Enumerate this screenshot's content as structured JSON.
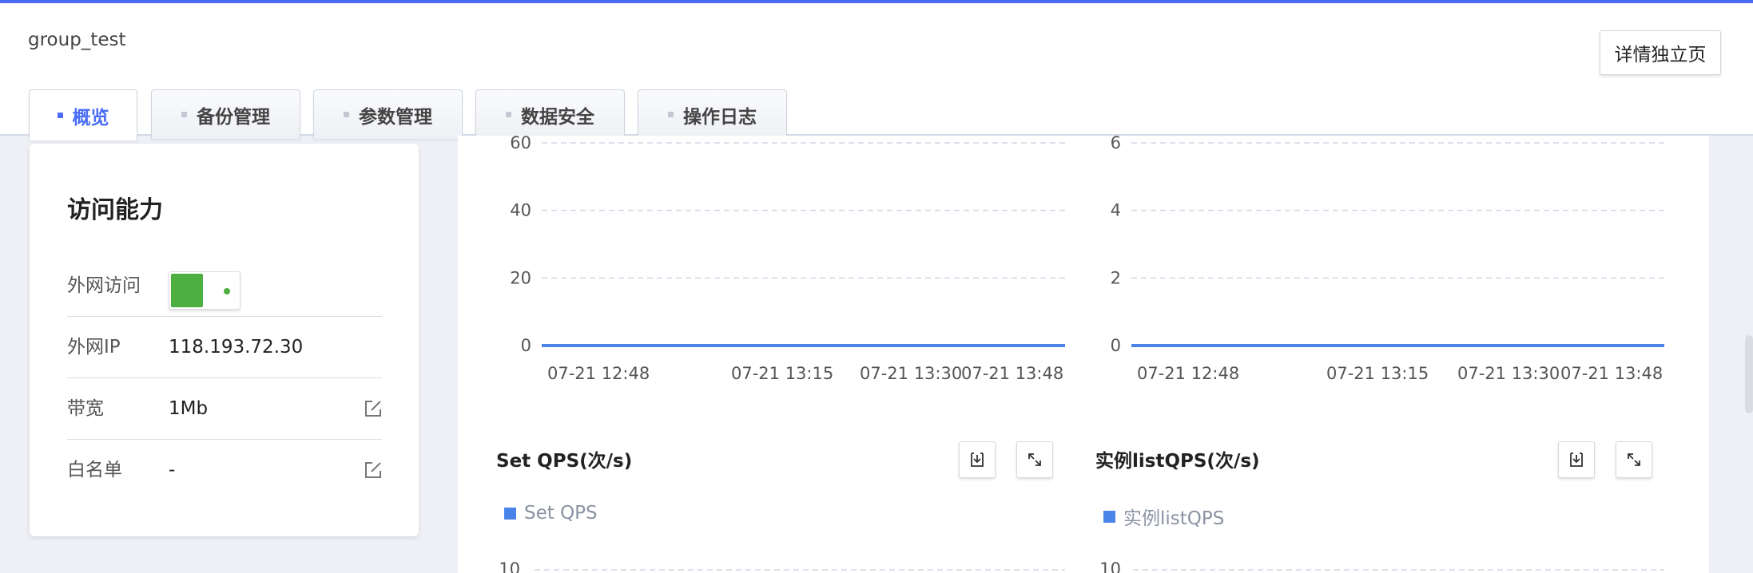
{
  "header": {
    "group_name": "group_test",
    "detail_button": "详情独立页"
  },
  "tabs": [
    {
      "label": "概览",
      "active": true
    },
    {
      "label": "备份管理",
      "active": false
    },
    {
      "label": "参数管理",
      "active": false
    },
    {
      "label": "数据安全",
      "active": false
    },
    {
      "label": "操作日志",
      "active": false
    }
  ],
  "access_card": {
    "title": "访问能力",
    "rows": [
      {
        "label": "外网访问",
        "toggle_on": true
      },
      {
        "label": "外网IP",
        "value": "118.193.72.30"
      },
      {
        "label": "带宽",
        "value": "1Mb",
        "editable": true
      },
      {
        "label": "白名单",
        "value": "-",
        "editable": true
      }
    ]
  },
  "colors": {
    "accent": "#4a6cf7",
    "series": "#4a84e8",
    "toggle_on": "#4caf3f"
  },
  "chart_data": [
    {
      "type": "line",
      "title": "",
      "x": [
        "07-21 12:48",
        "07-21 13:15",
        "07-21 13:30",
        "07-21 13:48"
      ],
      "series": [
        {
          "values": [
            0,
            0,
            0,
            0
          ]
        }
      ],
      "yticks": [
        0,
        20,
        40,
        60
      ],
      "ylim": [
        0,
        60
      ],
      "grid": true
    },
    {
      "type": "line",
      "title": "",
      "x": [
        "07-21 12:48",
        "07-21 13:15",
        "07-21 13:30",
        "07-21 13:48"
      ],
      "series": [
        {
          "values": [
            0,
            0,
            0,
            0
          ]
        }
      ],
      "yticks": [
        0,
        2,
        4,
        6
      ],
      "ylim": [
        0,
        6
      ],
      "grid": true
    },
    {
      "type": "line",
      "title": "Set QPS(次/s)",
      "series": [
        {
          "name": "Set QPS",
          "values": []
        }
      ],
      "yticks": [
        10
      ],
      "grid": true
    },
    {
      "type": "line",
      "title": "实例listQPS(次/s)",
      "series": [
        {
          "name": "实例listQPS",
          "values": []
        }
      ],
      "yticks": [
        10
      ],
      "grid": true
    }
  ],
  "panels": {
    "set_qps": {
      "title": "Set QPS(次/s)",
      "legend": "Set QPS",
      "download_icon": "download-icon",
      "expand_icon": "expand-icon"
    },
    "list_qps": {
      "title": "实例listQPS(次/s)",
      "legend": "实例listQPS",
      "download_icon": "download-icon",
      "expand_icon": "expand-icon"
    }
  }
}
